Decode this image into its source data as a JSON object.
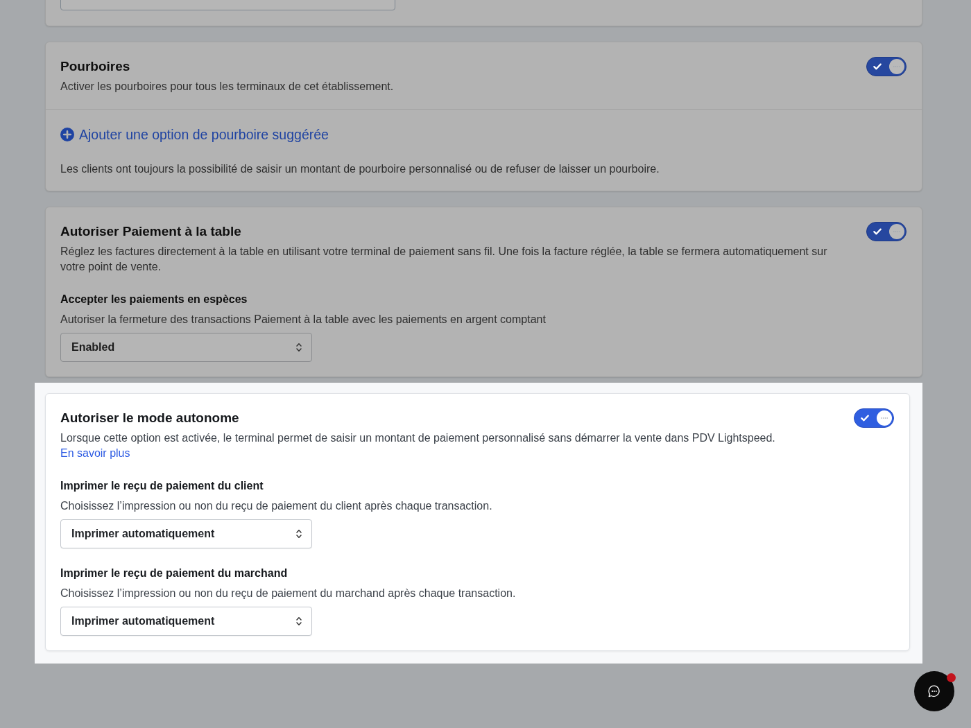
{
  "sections": [
    {
      "kind": "clipped",
      "highlighted": false
    },
    {
      "kind": "toggle_card",
      "highlighted": false,
      "title": "Pourboires",
      "description": "Activer les pourboires pour tous les terminaux de cet établissement.",
      "toggle": {
        "on": true
      },
      "footer": {
        "link": "Ajouter une option de pourboire suggérée",
        "note": "Les clients ont toujours la possibilité de saisir un montant de pourboire personnalisé ou de refuser de laisser un pourboire."
      }
    },
    {
      "kind": "toggle_card",
      "highlighted": false,
      "title": "Autoriser Paiement à la table",
      "description": "Réglez les factures directement à la table en utilisant votre terminal de paiement sans fil. Une fois la facture réglée, la table se fermera automatiquement sur votre point de vente.",
      "toggle": {
        "on": true
      },
      "settings": [
        {
          "label": "Accepter les paiements en espèces",
          "description": "Autoriser la fermeture des transactions Paiement à la table avec les paiements en argent comptant",
          "select": {
            "value": "Enabled"
          }
        }
      ]
    },
    {
      "kind": "toggle_card",
      "highlighted": true,
      "title": "Autoriser le mode autonome",
      "description": "Lorsque cette option est activée, le terminal permet de saisir un montant de paiement personnalisé sans démarrer la vente dans PDV Lightspeed.",
      "link": "En savoir plus",
      "toggle": {
        "on": true
      },
      "settings": [
        {
          "label": "Imprimer le reçu de paiement du client",
          "description": "Choisissez l’impression ou non du reçu de paiement du client après chaque transaction.",
          "select": {
            "value": "Imprimer automatiquement"
          }
        },
        {
          "label": "Imprimer le reçu de paiement du marchand",
          "description": "Choisissez l’impression ou non du reçu de paiement du marchand après chaque transaction.",
          "select": {
            "value": "Imprimer automatiquement"
          }
        }
      ]
    }
  ],
  "chat_button": {
    "unread": true
  }
}
